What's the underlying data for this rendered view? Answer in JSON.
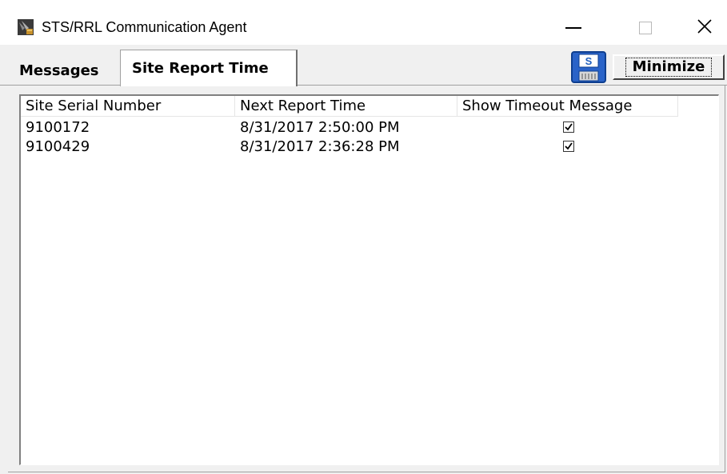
{
  "window": {
    "title": "STS/RRL Communication Agent",
    "minimize_glyph": "",
    "close_glyph": "✕"
  },
  "tabs": [
    {
      "label": "Messages",
      "active": false
    },
    {
      "label": "Site Report Time",
      "active": true
    }
  ],
  "toolbar": {
    "save_icon_letter": "S",
    "minimize_label": "Minimize"
  },
  "table": {
    "columns": [
      "Site Serial Number",
      "Next Report Time",
      "Show Timeout Message"
    ],
    "rows": [
      {
        "serial": "9100172",
        "next_report": "8/31/2017 2:50:00 PM",
        "show_timeout": true
      },
      {
        "serial": "9100429",
        "next_report": "8/31/2017 2:36:28 PM",
        "show_timeout": true
      }
    ]
  },
  "colors": {
    "accent_blue": "#1f5fbf",
    "window_bg": "#f0f0f0"
  }
}
